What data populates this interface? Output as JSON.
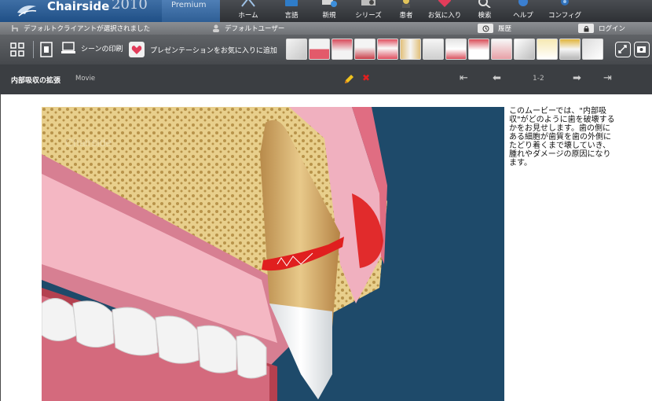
{
  "app": {
    "brand": "Chairside",
    "year": "2010",
    "edition": "Premium"
  },
  "nav": [
    {
      "label": "ホーム",
      "icon": "home-icon"
    },
    {
      "label": "言語",
      "icon": "globe-icon"
    },
    {
      "label": "新規",
      "icon": "new-icon"
    },
    {
      "label": "シリーズ",
      "icon": "film-icon"
    },
    {
      "label": "患者",
      "icon": "patient-icon"
    },
    {
      "label": "お気に入り",
      "icon": "heart-icon"
    },
    {
      "label": "検索",
      "icon": "search-icon"
    },
    {
      "label": "ヘルプ",
      "icon": "help-icon"
    },
    {
      "label": "コンフィグ",
      "icon": "gear-icon"
    }
  ],
  "status": {
    "client": "デフォルトクライアントが選択されました",
    "user": "デフォルトユーザー",
    "history": "履歴",
    "login": "ログイン"
  },
  "toolbar": {
    "print": "シーンの印刷",
    "add_favorite": "プレゼンテーションをお気に入りに追加"
  },
  "titlebar": {
    "title": "内部吸収の拡張",
    "kind": "Movie",
    "pages": "1-2"
  },
  "description": "このムービーでは、\"内部吸収\"がどのように歯を破壊するかをお見せします。歯の側にある細胞が歯質を歯の外側にたどり着くまで壊していき、腫れやダメージの原因になります。",
  "colors": {
    "header": "#3a3d41",
    "brand_blue": "#2d5f98",
    "movie_background": "#1e4a6a",
    "lesion_red": "#e01f1f"
  }
}
